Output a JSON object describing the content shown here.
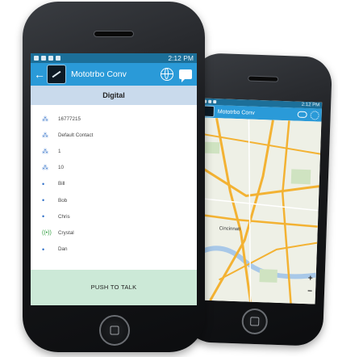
{
  "front_phone": {
    "status_bar": {
      "time": "2:12 PM"
    },
    "app_bar": {
      "title": "Mototrbo Conv",
      "back_icon": "back-arrow-icon",
      "globe_icon": "globe-icon",
      "chat_icon": "chat-icon"
    },
    "mode_label": "Digital",
    "contacts": [
      {
        "label": "16777215",
        "icon": "group-icon"
      },
      {
        "label": "Default Contact",
        "icon": "group-icon"
      },
      {
        "label": "1",
        "icon": "group-icon"
      },
      {
        "label": "10",
        "icon": "group-icon"
      },
      {
        "label": "Bill",
        "icon": "user-dot-icon"
      },
      {
        "label": "Bob",
        "icon": "user-dot-icon"
      },
      {
        "label": "Chris",
        "icon": "user-dot-icon"
      },
      {
        "label": "Crystal",
        "icon": "active-radio-icon"
      },
      {
        "label": "Dan",
        "icon": "user-dot-icon"
      }
    ],
    "push_to_talk_label": "PUSH TO TALK"
  },
  "back_phone": {
    "status_bar": {
      "time": "2:12 PM"
    },
    "app_bar": {
      "title": "Mototrbo Conv"
    },
    "map": {
      "city_label": "Cincinnati",
      "zoom_in": "+",
      "zoom_out": "−"
    }
  },
  "colors": {
    "app_bar": "#2a9ad8",
    "status_bar": "#1c6f99",
    "mode_bar": "#c9daec",
    "ptt_bar": "#cce9d7"
  }
}
